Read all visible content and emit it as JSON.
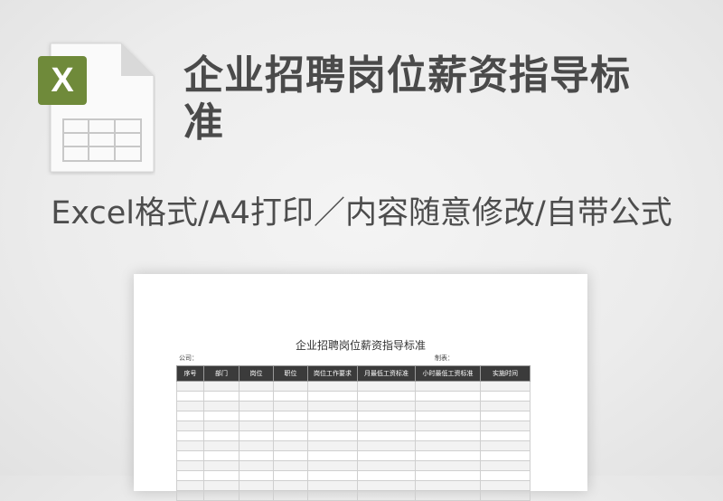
{
  "banner": {
    "title": "企业招聘岗位薪资指导标准",
    "subtitle": "Excel格式/A4打印／内容随意修改/自带公式"
  },
  "file_icon": {
    "name": "excel-file-icon",
    "badge_letter": "X",
    "badge_color": "#6f8a3a"
  },
  "document": {
    "title": "企业招聘岗位薪资指导标准",
    "company_label": "公司：",
    "maker_label": "制表：",
    "columns": [
      "序号",
      "部门",
      "岗位",
      "职位",
      "岗位工作要求",
      "月最低工资标准",
      "小时最低工资标准",
      "实施时间"
    ]
  }
}
